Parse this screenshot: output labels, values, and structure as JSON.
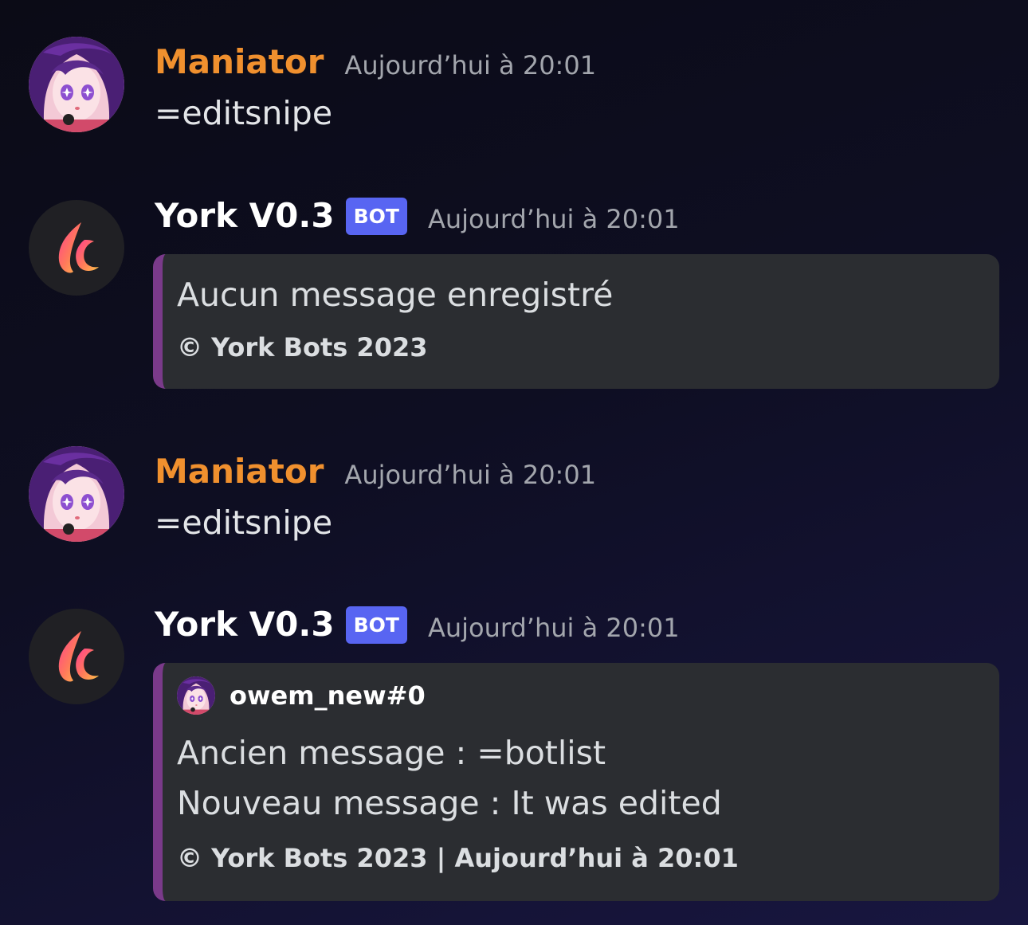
{
  "messages": [
    {
      "author": "Maniator",
      "timestamp": "Aujourd’hui à 20:01",
      "content": "=editsnipe",
      "avatar": "anime-girl-avatar"
    },
    {
      "author": "York V0.3",
      "badge": "BOT",
      "timestamp": "Aujourd’hui à 20:01",
      "avatar": "flame-logo-avatar",
      "embed": {
        "description": "Aucun message enregistré",
        "footer": "© York Bots 2023"
      }
    },
    {
      "author": "Maniator",
      "timestamp": "Aujourd’hui à 20:01",
      "content": "=editsnipe",
      "avatar": "anime-girl-avatar"
    },
    {
      "author": "York V0.3",
      "badge": "BOT",
      "timestamp": "Aujourd’hui à 20:01",
      "avatar": "flame-logo-avatar",
      "embed": {
        "author": "owem_new#0",
        "description_lines": [
          "Ancien message : =botlist",
          "Nouveau message : It was edited"
        ],
        "footer": "© York Bots 2023 | Aujourd’hui à 20:01"
      }
    }
  ],
  "colors": {
    "user_name": "#f0902e",
    "bot_badge": "#5865f2",
    "embed_bg": "#2b2d31",
    "embed_border": "#7a3a8a"
  }
}
